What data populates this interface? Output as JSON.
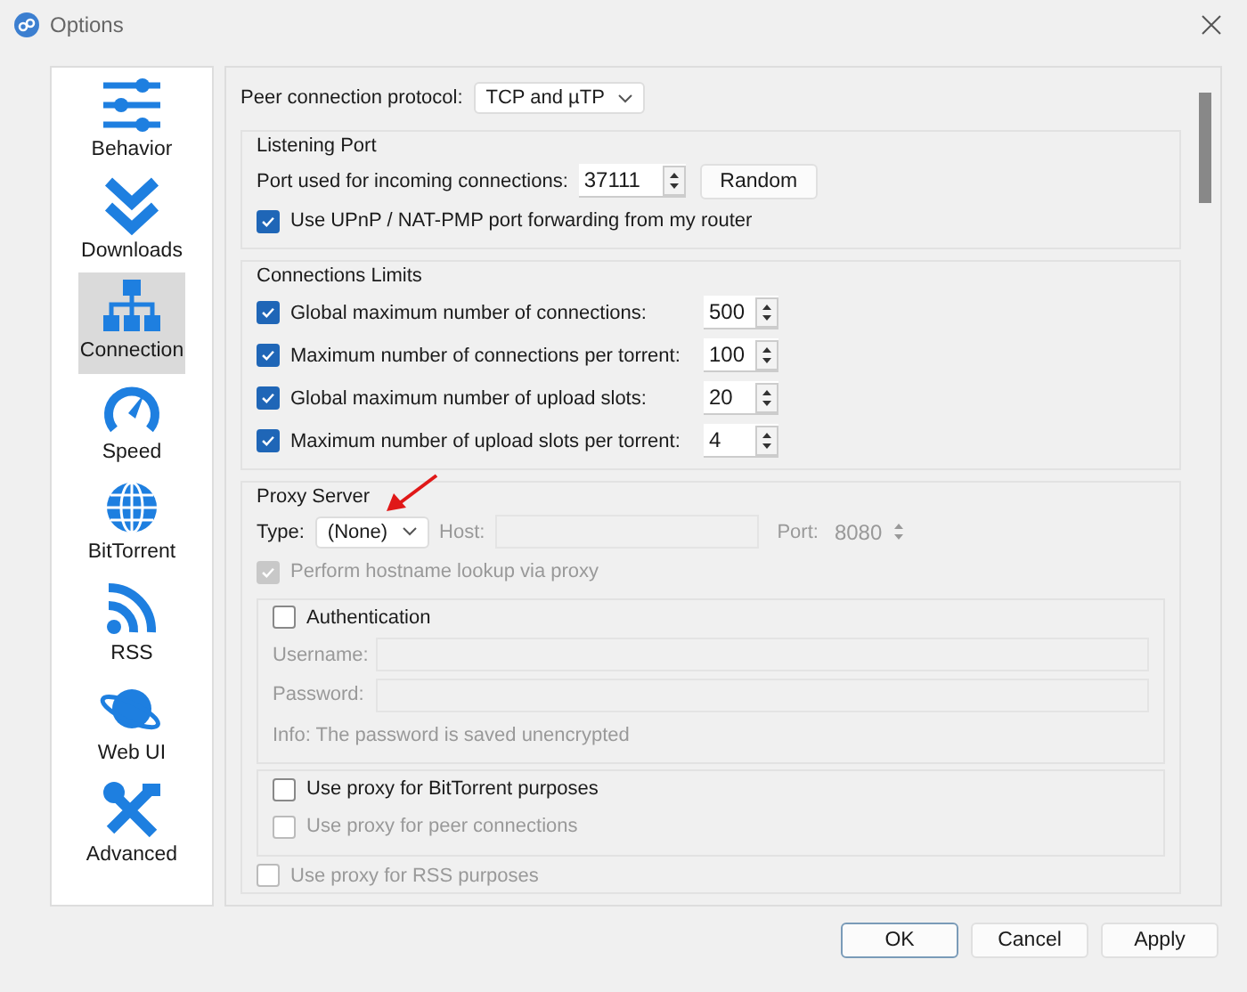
{
  "window": {
    "title": "Options"
  },
  "sidebar": {
    "items": [
      {
        "label": "Behavior",
        "selected": false
      },
      {
        "label": "Downloads",
        "selected": false
      },
      {
        "label": "Connection",
        "selected": true
      },
      {
        "label": "Speed",
        "selected": false
      },
      {
        "label": "BitTorrent",
        "selected": false
      },
      {
        "label": "RSS",
        "selected": false
      },
      {
        "label": "Web UI",
        "selected": false
      },
      {
        "label": "Advanced",
        "selected": false
      }
    ]
  },
  "protocol": {
    "label": "Peer connection protocol:",
    "value": "TCP and µTP"
  },
  "listening_port": {
    "title": "Listening Port",
    "port_label": "Port used for incoming connections:",
    "port_value": "37111",
    "random_button": "Random",
    "upnp": {
      "label": "Use UPnP / NAT-PMP port forwarding from my router",
      "checked": true
    }
  },
  "connection_limits": {
    "title": "Connections Limits",
    "rows": [
      {
        "label": "Global maximum number of connections:",
        "checked": true,
        "value": "500"
      },
      {
        "label": "Maximum number of connections per torrent:",
        "checked": true,
        "value": "100"
      },
      {
        "label": "Global maximum number of upload slots:",
        "checked": true,
        "value": "20"
      },
      {
        "label": "Maximum number of upload slots per torrent:",
        "checked": true,
        "value": "4"
      }
    ]
  },
  "proxy": {
    "title": "Proxy Server",
    "type_label": "Type:",
    "type_value": "(None)",
    "host_label": "Host:",
    "port_label": "Port:",
    "port_value": "8080",
    "fields_disabled": true,
    "hostname_lookup": {
      "label": "Perform hostname lookup via proxy",
      "checked": true,
      "disabled": true
    },
    "authentication": {
      "label": "Authentication",
      "checked": false,
      "disabled": false,
      "username_label": "Username:",
      "password_label": "Password:",
      "info": "Info: The password is saved unencrypted",
      "fields_disabled": true
    },
    "bittorrent": {
      "label": "Use proxy for BitTorrent purposes",
      "checked": false,
      "disabled": false
    },
    "peer_connections": {
      "label": "Use proxy for peer connections",
      "checked": false,
      "disabled": true
    },
    "rss": {
      "label": "Use proxy for RSS purposes",
      "checked": false,
      "disabled": true
    }
  },
  "buttons": [
    {
      "label": "OK",
      "default": true
    },
    {
      "label": "Cancel",
      "default": false
    },
    {
      "label": "Apply",
      "default": false
    }
  ]
}
